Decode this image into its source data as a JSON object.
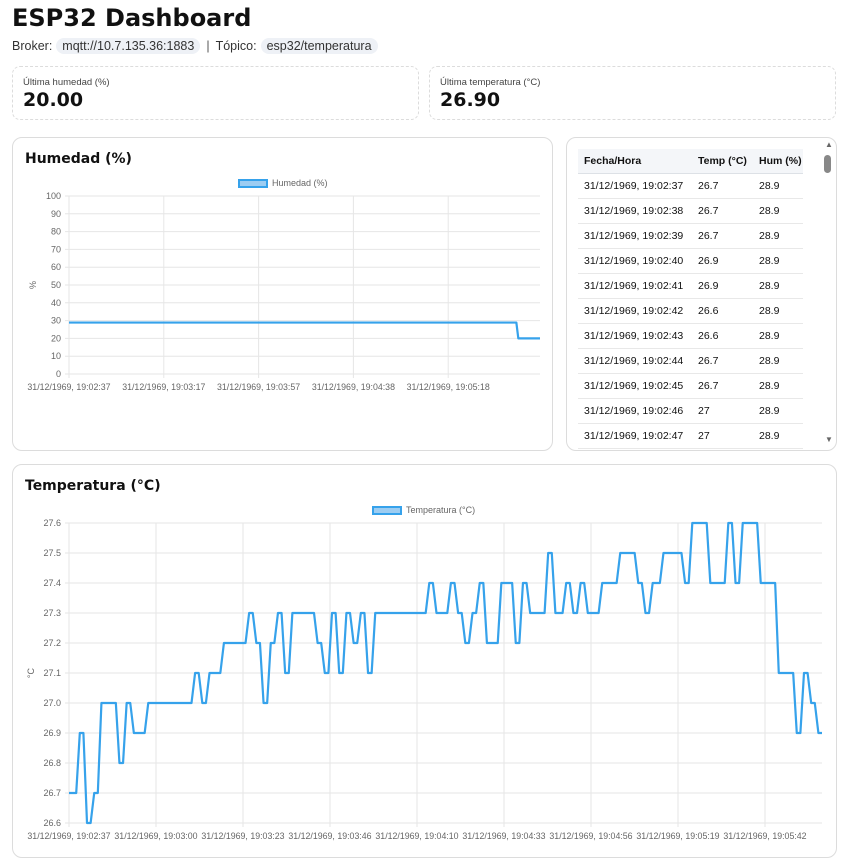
{
  "header": {
    "title": "ESP32 Dashboard",
    "broker_label": "Broker:",
    "broker_value": "mqtt://10.7.135.36:1883",
    "separator": "|",
    "topic_label": "Tópico:",
    "topic_value": "esp32/temperatura"
  },
  "stats": {
    "humidity_label": "Última humedad (%)",
    "humidity_value": "20.00",
    "temperature_label": "Última temperatura (°C)",
    "temperature_value": "26.90"
  },
  "humidity_card": {
    "title": "Humedad (%)"
  },
  "temperature_card": {
    "title": "Temperatura (°C)"
  },
  "table": {
    "headers": [
      "Fecha/Hora",
      "Temp (°C)",
      "Hum (%)"
    ],
    "rows": [
      [
        "31/12/1969, 19:02:37",
        "26.7",
        "28.9"
      ],
      [
        "31/12/1969, 19:02:38",
        "26.7",
        "28.9"
      ],
      [
        "31/12/1969, 19:02:39",
        "26.7",
        "28.9"
      ],
      [
        "31/12/1969, 19:02:40",
        "26.9",
        "28.9"
      ],
      [
        "31/12/1969, 19:02:41",
        "26.9",
        "28.9"
      ],
      [
        "31/12/1969, 19:02:42",
        "26.6",
        "28.9"
      ],
      [
        "31/12/1969, 19:02:43",
        "26.6",
        "28.9"
      ],
      [
        "31/12/1969, 19:02:44",
        "26.7",
        "28.9"
      ],
      [
        "31/12/1969, 19:02:45",
        "26.7",
        "28.9"
      ],
      [
        "31/12/1969, 19:02:46",
        "27",
        "28.9"
      ],
      [
        "31/12/1969, 19:02:47",
        "27",
        "28.9"
      ]
    ]
  },
  "colors": {
    "line": "#36a2eb",
    "legend_fill": "#9dcdf2",
    "grid": "#e6e6e6"
  },
  "chart_data": [
    {
      "type": "line",
      "title": "Humedad (%)",
      "ylabel": "%",
      "ylim": [
        0,
        100
      ],
      "yticks": [
        0,
        10,
        20,
        30,
        40,
        50,
        60,
        70,
        80,
        90,
        100
      ],
      "xticks": [
        "31/12/1969, 19:02:37",
        "31/12/1969, 19:03:17",
        "31/12/1969, 19:03:57",
        "31/12/1969, 19:04:38",
        "31/12/1969, 19:05:18"
      ],
      "series": [
        {
          "name": "Humedad (%)",
          "values": [
            28.9,
            28.9,
            28.9,
            28.9,
            28.9,
            28.9,
            28.9,
            28.9,
            28.9,
            28.9,
            28.9,
            28.9,
            28.9,
            28.9,
            28.9,
            28.9,
            28.9,
            28.9,
            28.9,
            28.9,
            28.9,
            28.9,
            28.9,
            28.9,
            28.9,
            28.9,
            28.9,
            28.9,
            28.9,
            28.9,
            28.9,
            28.9,
            28.9,
            28.9,
            28.9,
            28.9,
            28.9,
            28.9,
            28.9,
            28.9,
            28.9,
            28.9,
            28.9,
            28.9,
            28.9,
            28.9,
            28.9,
            28.9,
            28.9,
            28.9,
            28.9,
            28.9,
            28.9,
            28.9,
            28.9,
            28.9,
            28.9,
            28.9,
            28.9,
            28.9,
            28.9,
            28.9,
            28.9,
            28.9,
            28.9,
            28.9,
            28.9,
            28.9,
            28.9,
            28.9,
            28.9,
            28.9,
            28.9,
            28.9,
            28.9,
            28.9,
            28.9,
            28.9,
            28.9,
            28.9,
            28.9,
            28.9,
            28.9,
            28.9,
            28.9,
            28.9,
            28.9,
            28.9,
            28.9,
            28.9,
            28.9,
            28.9,
            28.9,
            28.9,
            28.9,
            28.9,
            28.9,
            28.9,
            28.9,
            28.9,
            28.9,
            28.9,
            28.9,
            28.9,
            28.9,
            28.9,
            28.9,
            28.9,
            28.9,
            28.9,
            28.9,
            28.9,
            28.9,
            28.9,
            28.9,
            28.9,
            28.9,
            28.9,
            28.9,
            28.9,
            28.9,
            28.9,
            28.9,
            28.9,
            28.9,
            28.9,
            28.9,
            28.9,
            28.9,
            28.9,
            28.9,
            28.9,
            28.9,
            28.9,
            28.9,
            28.9,
            28.9,
            28.9,
            28.9,
            28.9,
            28.9,
            28.9,
            28.9,
            28.9,
            28.9,
            28.9,
            28.9,
            28.9,
            28.9,
            28.9,
            28.9,
            28.9,
            28.9,
            28.9,
            28.9,
            28.9,
            28.9,
            28.9,
            28.9,
            28.9,
            28.9,
            28.9,
            28.9,
            28.9,
            28.9,
            28.9,
            28.9,
            28.9,
            28.9,
            28.9,
            28.9,
            28.9,
            28.9,
            28.9,
            28.9,
            28.9,
            28.9,
            28.9,
            28.9,
            28.9,
            28.9,
            28.9,
            28.9,
            28.9,
            28.9,
            28.9,
            28.9,
            28.9,
            28.9,
            28.9,
            28.9,
            28.9,
            28.9,
            28.9,
            28.9,
            28.9,
            28.9,
            28.9,
            28.9,
            28.9,
            28.9,
            28.9,
            28.9,
            28.9,
            28.9,
            28.9,
            28.9,
            28.9,
            28.9,
            28.9,
            28.9,
            28.9,
            28.9,
            28.9,
            28.9,
            28.9,
            28.9,
            28.9,
            28.9,
            28.9,
            28.9,
            28.9,
            28.9,
            28.9,
            28.9,
            28.9,
            28.9,
            28.9,
            20,
            20,
            20,
            20,
            20,
            20,
            20,
            20,
            20,
            20,
            20,
            20
          ]
        }
      ]
    },
    {
      "type": "line",
      "title": "Temperatura (°C)",
      "ylabel": "°C",
      "ylim": [
        26.6,
        27.6
      ],
      "yticks": [
        26.6,
        26.7,
        26.8,
        26.9,
        27.0,
        27.1,
        27.2,
        27.3,
        27.4,
        27.5,
        27.6
      ],
      "xticks": [
        "31/12/1969, 19:02:37",
        "31/12/1969, 19:03:00",
        "31/12/1969, 19:03:23",
        "31/12/1969, 19:03:46",
        "31/12/1969, 19:04:10",
        "31/12/1969, 19:04:33",
        "31/12/1969, 19:04:56",
        "31/12/1969, 19:05:19",
        "31/12/1969, 19:05:42"
      ],
      "series": [
        {
          "name": "Temperatura (°C)",
          "values": [
            26.7,
            26.7,
            26.7,
            26.9,
            26.9,
            26.6,
            26.6,
            26.7,
            26.7,
            27,
            27,
            27,
            27,
            27,
            26.8,
            26.8,
            27,
            27,
            26.9,
            26.9,
            26.9,
            26.9,
            27,
            27,
            27,
            27,
            27,
            27,
            27,
            27,
            27,
            27,
            27,
            27,
            27,
            27.1,
            27.1,
            27,
            27,
            27.1,
            27.1,
            27.1,
            27.1,
            27.2,
            27.2,
            27.2,
            27.2,
            27.2,
            27.2,
            27.2,
            27.3,
            27.3,
            27.2,
            27.2,
            27,
            27,
            27.2,
            27.2,
            27.3,
            27.3,
            27.1,
            27.1,
            27.3,
            27.3,
            27.3,
            27.3,
            27.3,
            27.3,
            27.3,
            27.2,
            27.2,
            27.1,
            27.1,
            27.3,
            27.3,
            27.1,
            27.1,
            27.3,
            27.3,
            27.2,
            27.2,
            27.3,
            27.3,
            27.1,
            27.1,
            27.3,
            27.3,
            27.3,
            27.3,
            27.3,
            27.3,
            27.3,
            27.3,
            27.3,
            27.3,
            27.3,
            27.3,
            27.3,
            27.3,
            27.3,
            27.4,
            27.4,
            27.3,
            27.3,
            27.3,
            27.3,
            27.4,
            27.4,
            27.3,
            27.3,
            27.2,
            27.2,
            27.3,
            27.3,
            27.4,
            27.4,
            27.2,
            27.2,
            27.2,
            27.2,
            27.4,
            27.4,
            27.4,
            27.4,
            27.2,
            27.2,
            27.4,
            27.4,
            27.3,
            27.3,
            27.3,
            27.3,
            27.3,
            27.5,
            27.5,
            27.3,
            27.3,
            27.3,
            27.4,
            27.4,
            27.3,
            27.3,
            27.4,
            27.4,
            27.3,
            27.3,
            27.3,
            27.3,
            27.4,
            27.4,
            27.4,
            27.4,
            27.4,
            27.5,
            27.5,
            27.5,
            27.5,
            27.5,
            27.4,
            27.4,
            27.3,
            27.3,
            27.4,
            27.4,
            27.4,
            27.5,
            27.5,
            27.5,
            27.5,
            27.5,
            27.5,
            27.4,
            27.4,
            27.6,
            27.6,
            27.6,
            27.6,
            27.6,
            27.4,
            27.4,
            27.4,
            27.4,
            27.4,
            27.6,
            27.6,
            27.4,
            27.4,
            27.6,
            27.6,
            27.6,
            27.6,
            27.6,
            27.4,
            27.4,
            27.4,
            27.4,
            27.4,
            27.1,
            27.1,
            27.1,
            27.1,
            27.1,
            26.9,
            26.9,
            27.1,
            27.1,
            27,
            27,
            26.9,
            26.9
          ]
        }
      ]
    }
  ]
}
